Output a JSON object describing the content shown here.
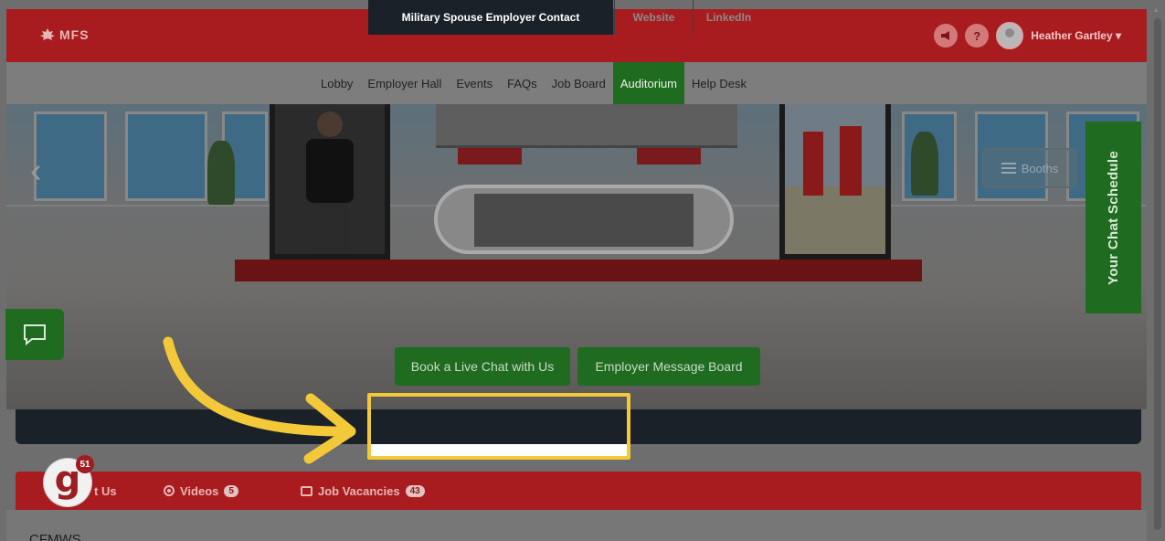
{
  "header": {
    "logo_text": "MFS",
    "notification_icon": "megaphone-icon",
    "help_label": "?",
    "user_name": "Heather Gartley ▾"
  },
  "nav": {
    "items": [
      {
        "label": "Lobby",
        "active": false
      },
      {
        "label": "Employer Hall",
        "active": false
      },
      {
        "label": "Events",
        "active": false
      },
      {
        "label": "FAQs",
        "active": false
      },
      {
        "label": "Job Board",
        "active": false
      },
      {
        "label": "Auditorium",
        "active": true
      },
      {
        "label": "Help Desk",
        "active": false
      }
    ]
  },
  "booth": {
    "booths_label": "Booths",
    "schedule_label": "Your Chat Schedule",
    "book_chat_label": "Book a Live Chat with Us",
    "message_board_label": "Employer Message Board"
  },
  "tabs": {
    "active": "Military Spouse Employer Contact",
    "website": "Website",
    "linkedin": "LinkedIn"
  },
  "sections": {
    "about_label": "t Us",
    "videos_label": "Videos",
    "videos_count": "5",
    "jobs_label": "Job Vacancies",
    "jobs_count": "43"
  },
  "badge": {
    "letter": "g",
    "count": "51"
  },
  "company_name": "CFMWS",
  "colors": {
    "brand_red": "#a81c20",
    "green": "#1f6b1f",
    "highlight_yellow": "#f3c93a",
    "dark_bar": "#1b2129"
  }
}
